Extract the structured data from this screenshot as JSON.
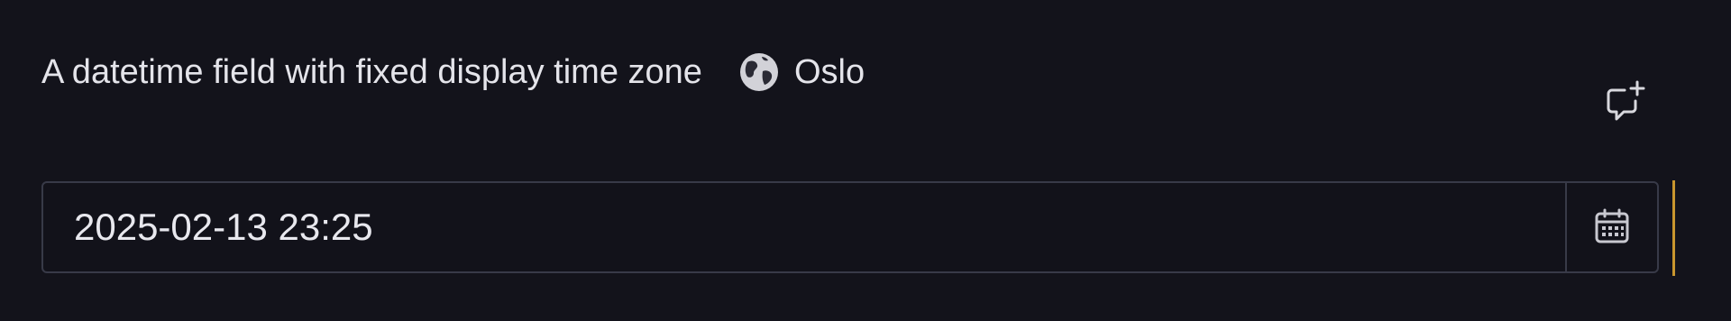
{
  "field": {
    "label": "A datetime field with fixed display time zone",
    "timezone": {
      "icon": "globe-icon",
      "name": "Oslo"
    },
    "value": "2025-02-13 23:25",
    "calendar_icon": "calendar-icon",
    "comment_icon": "add-comment-icon"
  },
  "colors": {
    "background": "#13131b",
    "text": "#e4e4ea",
    "border": "#383a48",
    "change_indicator": "#c9962e"
  }
}
